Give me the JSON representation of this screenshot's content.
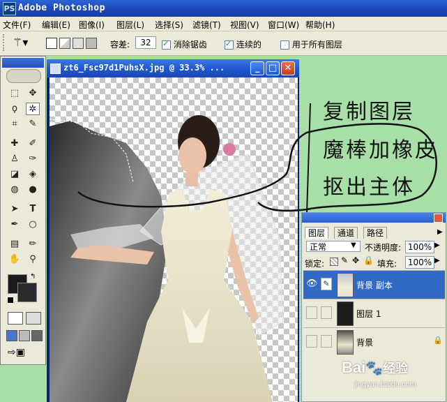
{
  "app": {
    "title": "Adobe Photoshop",
    "logo": "PS"
  },
  "menu": [
    "文件(F)",
    "编辑(E)",
    "图像(I)",
    "图层(L)",
    "选择(S)",
    "滤镜(T)",
    "视图(V)",
    "窗口(W)",
    "帮助(H)"
  ],
  "options": {
    "tolerance_label": "容差:",
    "tolerance_value": "32",
    "antialias_label": "消除锯齿",
    "contiguous_label": "连续的",
    "all_layers_label": "用于所有图层"
  },
  "document": {
    "title": "zt6_Fsc97d1PuhsX.jpg @ 33.3% ..."
  },
  "annotation": {
    "line1": "复制图层",
    "line2": "魔棒加橡皮",
    "line3": "抠出主体"
  },
  "layers_panel": {
    "tabs": [
      "图层",
      "通道",
      "路径"
    ],
    "blend_mode": "正常",
    "opacity_label": "不透明度:",
    "opacity_value": "100%",
    "lock_label": "锁定:",
    "fill_label": "填充:",
    "fill_value": "100%",
    "layers": [
      {
        "name": "背景 副本",
        "active": true,
        "visible": true
      },
      {
        "name": "图层 1",
        "active": false,
        "visible": false
      },
      {
        "name": "背景",
        "active": false,
        "visible": false,
        "locked": true
      }
    ]
  },
  "watermark": {
    "text": "Bai",
    "brand": "经验",
    "url": "jingyan.baidu.com"
  },
  "colors": {
    "selection": "#316ac5",
    "title_bar": "#1f55cf",
    "desktop": "#a7dfa7"
  }
}
